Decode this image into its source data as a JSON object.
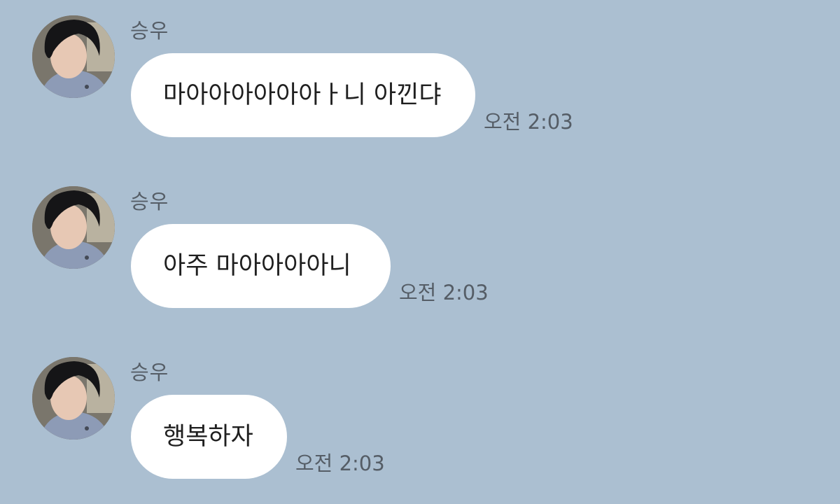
{
  "colors": {
    "background": "#abbfd1",
    "bubble": "#ffffff",
    "meta_text": "#555d66",
    "message_text": "#1f1f1f"
  },
  "messages": [
    {
      "sender": "승우",
      "avatar_icon": "profile-photo",
      "text": "마아아아아아아ㅏ니 아낀댜",
      "time": "오전 2:03"
    },
    {
      "sender": "승우",
      "avatar_icon": "profile-photo",
      "text": "아주 마아아아아니",
      "time": "오전 2:03"
    },
    {
      "sender": "승우",
      "avatar_icon": "profile-photo",
      "text": "행복하자",
      "time": "오전 2:03"
    }
  ]
}
